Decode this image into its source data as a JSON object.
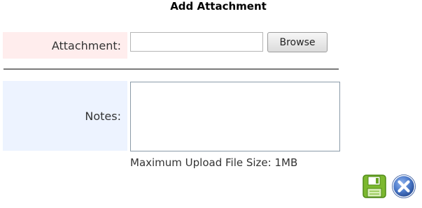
{
  "dialog": {
    "title": "Add Attachment"
  },
  "attachment": {
    "label": "Attachment:",
    "value": "",
    "browse_label": "Browse"
  },
  "notes": {
    "label": "Notes:",
    "value": ""
  },
  "info": {
    "max_upload": "Maximum Upload File Size: 1MB"
  },
  "actions": {
    "save_icon": "save-disk-icon",
    "cancel_icon": "cancel-x-icon"
  },
  "colors": {
    "attachment_label_bg": "#ffeded",
    "notes_label_bg": "#edf3ff",
    "save_green": "#7cb82f",
    "cancel_blue": "#4a78c8"
  }
}
